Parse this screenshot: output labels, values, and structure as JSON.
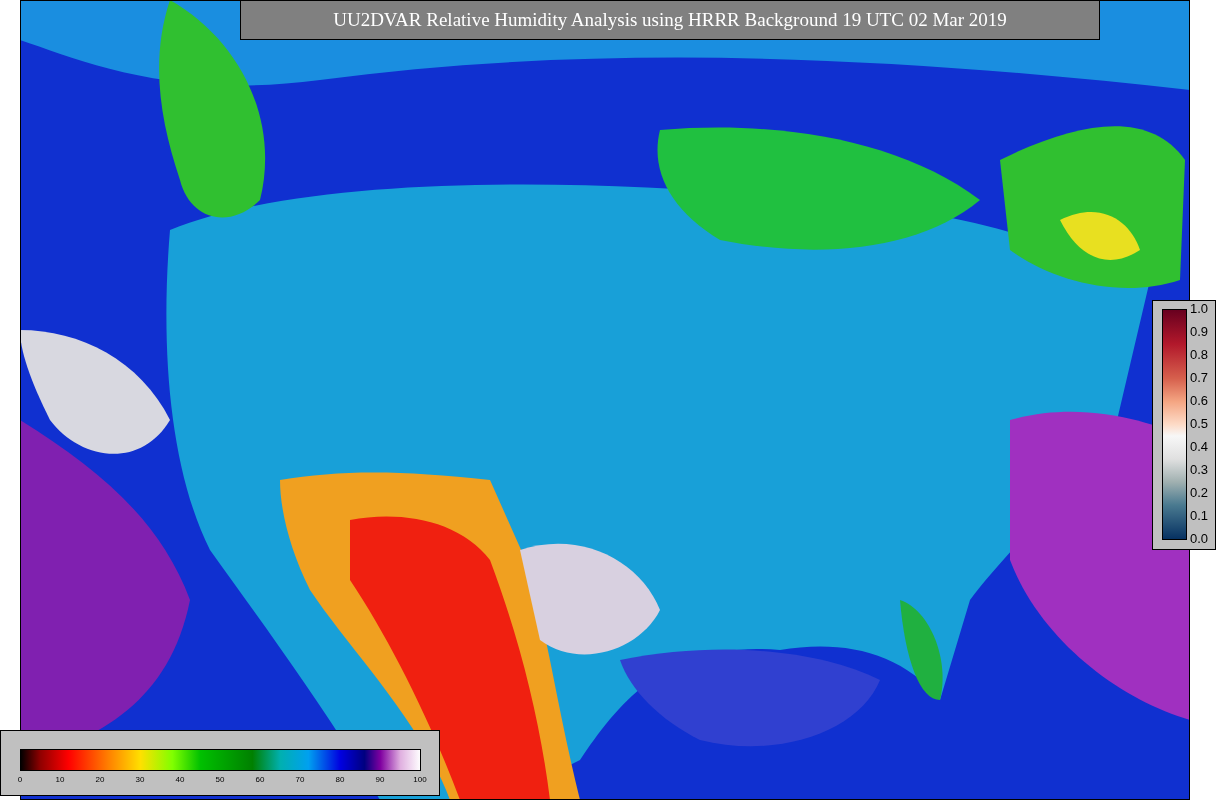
{
  "title": "UU2DVAR Relative Humidity Analysis using HRRR Background 19 UTC 02 Mar 2019",
  "side_colorbar": {
    "ticks": [
      "1.0",
      "0.9",
      "0.8",
      "0.7",
      "0.6",
      "0.5",
      "0.4",
      "0.3",
      "0.2",
      "0.1",
      "0.0"
    ]
  },
  "bottom_colorbar": {
    "ticks": [
      "0",
      "10",
      "20",
      "30",
      "40",
      "50",
      "60",
      "70",
      "80",
      "90",
      "100"
    ]
  }
}
